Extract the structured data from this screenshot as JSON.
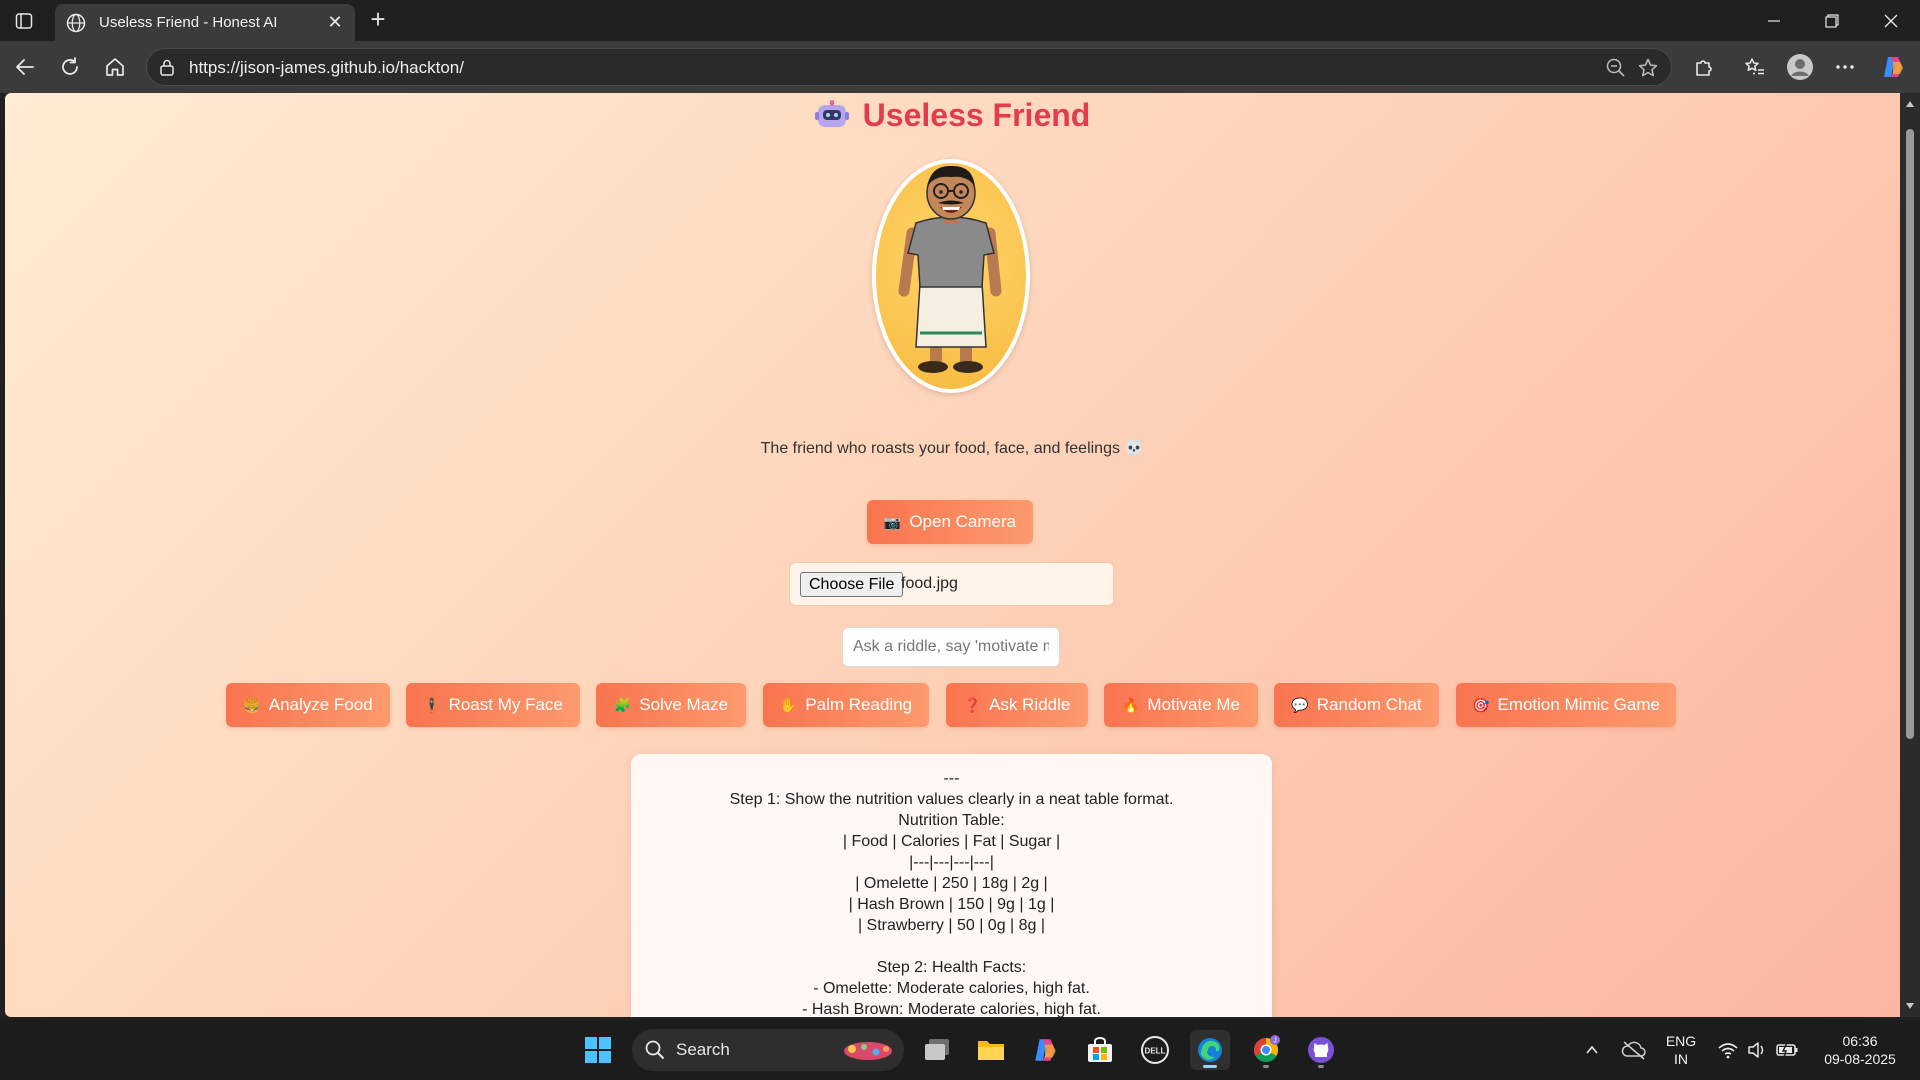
{
  "browser": {
    "tab_title": "Useless Friend - Honest AI",
    "url": "https://jison-james.github.io/hackton/"
  },
  "app": {
    "title": "Useless Friend",
    "tagline": "The friend who roasts your food, face, and feelings 💀",
    "open_camera_label": "Open Camera",
    "choose_file_label": "Choose File",
    "file_name": "food.jpg",
    "prompt_placeholder": "Ask a riddle, say 'motivate me'...",
    "actions": [
      {
        "icon": "🍔",
        "label": "Analyze Food"
      },
      {
        "icon": "🕴",
        "label": "Roast My Face"
      },
      {
        "icon": "🧩",
        "label": "Solve Maze"
      },
      {
        "icon": "✋",
        "label": "Palm Reading"
      },
      {
        "icon": "❓",
        "label": "Ask Riddle"
      },
      {
        "icon": "🔥",
        "label": "Motivate Me"
      },
      {
        "icon": "💬",
        "label": "Random Chat"
      },
      {
        "icon": "🎯",
        "label": "Emotion Mimic Game"
      }
    ],
    "output_lines": [
      "---",
      "Step 1: Show the nutrition values clearly in a neat table format.",
      "Nutrition Table:",
      "| Food | Calories | Fat | Sugar |",
      "|---|---|---|---|",
      "| Omelette | 250 | 18g | 2g |",
      "| Hash Brown | 150 | 9g | 1g |",
      "| Strawberry | 50 | 0g | 8g |",
      "",
      "Step 2: Health Facts:",
      "- Omelette: Moderate calories, high fat.",
      "- Hash Brown: Moderate calories, high fat."
    ]
  },
  "taskbar": {
    "search_label": "Search",
    "language_line1": "ENG",
    "language_line2": "IN",
    "time": "06:36",
    "date": "09-08-2025"
  },
  "colors": {
    "title": "#e23c4d",
    "button_start": "#f9744f",
    "button_end": "#fd9a6e",
    "background_start": "#ffecd2",
    "background_end": "#fcb69f"
  }
}
